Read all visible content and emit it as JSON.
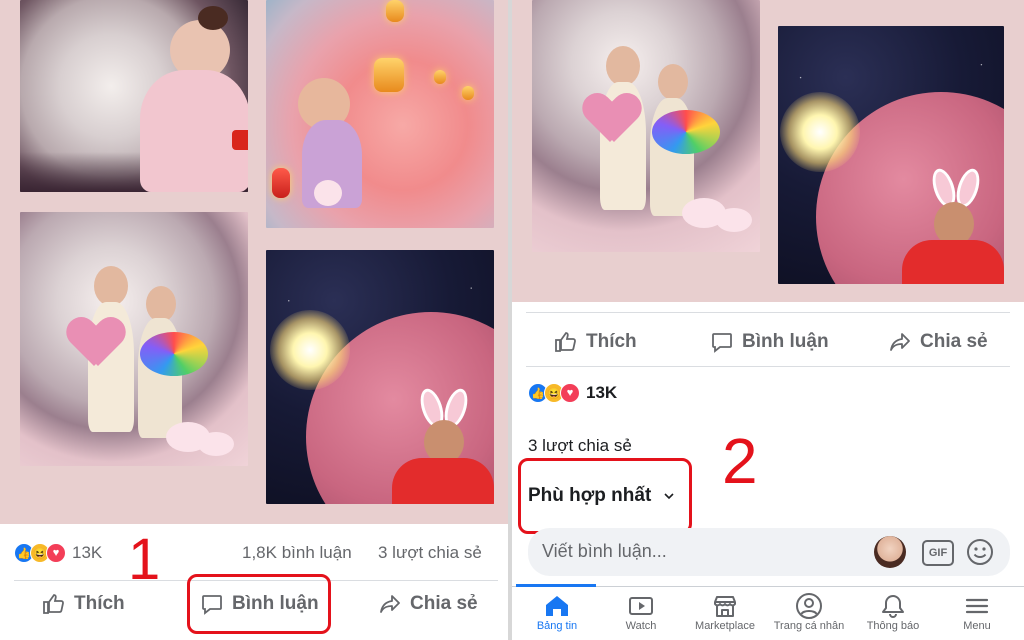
{
  "left": {
    "reactions_count": "13K",
    "comments_count": "1,8K bình luận",
    "shares_count": "3 lượt chia sẻ",
    "actions": {
      "like": "Thích",
      "comment": "Bình luận",
      "share": "Chia sẻ"
    },
    "step_number": "1"
  },
  "right": {
    "actions": {
      "like": "Thích",
      "comment": "Bình luận",
      "share": "Chia sẻ"
    },
    "reactions_count": "13K",
    "shares_count": "3 lượt chia sẻ",
    "sort_label": "Phù hợp nhất",
    "comment_placeholder": "Viết bình luận...",
    "gif_label": "GIF",
    "step_number": "2",
    "tabs": [
      {
        "label": "Bảng tin",
        "icon": "home-icon",
        "active": true
      },
      {
        "label": "Watch",
        "icon": "video-icon",
        "active": false
      },
      {
        "label": "Marketplace",
        "icon": "shop-icon",
        "active": false
      },
      {
        "label": "Trang cá nhân",
        "icon": "profile-icon",
        "active": false
      },
      {
        "label": "Thông báo",
        "icon": "bell-icon",
        "active": false
      },
      {
        "label": "Menu",
        "icon": "menu-icon",
        "active": false
      }
    ]
  },
  "colors": {
    "accent": "#1877f2",
    "highlight": "#e4121b",
    "text": "#65676b"
  }
}
